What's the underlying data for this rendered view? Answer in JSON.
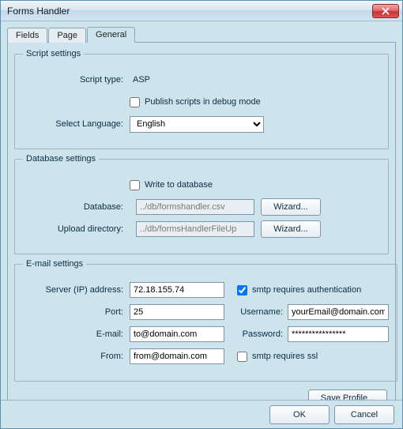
{
  "window": {
    "title": "Forms Handler"
  },
  "tabs": {
    "fields": "Fields",
    "page": "Page",
    "general": "General"
  },
  "script_settings": {
    "legend": "Script settings",
    "type_label": "Script type:",
    "type_value": "ASP",
    "debug_label": "Publish scripts in debug mode",
    "debug_checked": false,
    "language_label": "Select Language:",
    "language_value": "English"
  },
  "database_settings": {
    "legend": "Database settings",
    "write_label": "Write to database",
    "write_checked": false,
    "database_label": "Database:",
    "database_value": "../db/formshandler.csv",
    "upload_label": "Upload directory:",
    "upload_value": "../db/formsHandlerFileUp",
    "wizard_label": "Wizard..."
  },
  "email_settings": {
    "legend": "E-mail settings",
    "server_label": "Server (IP) address:",
    "server_value": "72.18.155.74",
    "auth_label": "smtp requires authentication",
    "auth_checked": true,
    "port_label": "Port:",
    "port_value": "25",
    "username_label": "Username:",
    "username_value": "yourEmail@domain.com",
    "email_label": "E-mail:",
    "email_value": "to@domain.com",
    "password_label": "Password:",
    "password_value": "****************",
    "from_label": "From:",
    "from_value": "from@domain.com",
    "ssl_label": "smtp requires ssl",
    "ssl_checked": false
  },
  "buttons": {
    "save_profile": "Save Profile...",
    "ok": "OK",
    "cancel": "Cancel"
  }
}
